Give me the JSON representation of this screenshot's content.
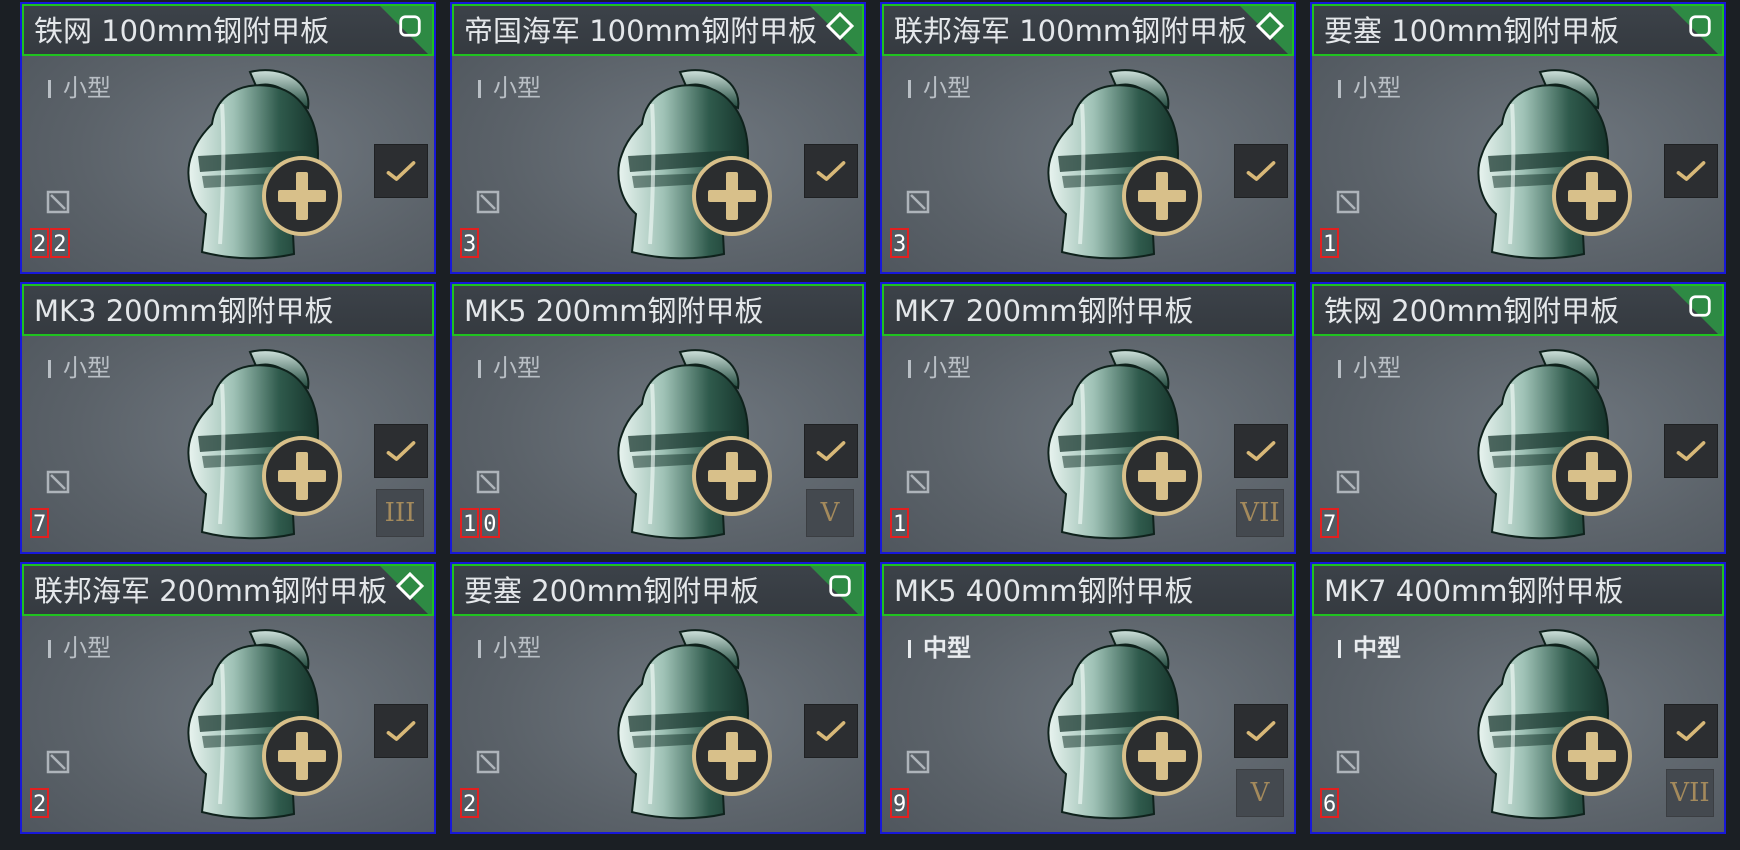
{
  "colors": {
    "card_border": "#1818d8",
    "title_border": "#1fc21f",
    "corner_badge": "#2e8a44",
    "count_border": "#e22020",
    "gold": "#d8c08a"
  },
  "items": [
    {
      "name": "铁网 100mm钢附甲板",
      "size": "小型",
      "count": "22",
      "tier": "",
      "corner": "square-icon",
      "medium": false
    },
    {
      "name": "帝国海军 100mm钢附甲板",
      "size": "小型",
      "count": "3",
      "tier": "",
      "corner": "diamond-icon",
      "medium": false
    },
    {
      "name": "联邦海军 100mm钢附甲板",
      "size": "小型",
      "count": "3",
      "tier": "",
      "corner": "diamond-icon",
      "medium": false
    },
    {
      "name": "要塞 100mm钢附甲板",
      "size": "小型",
      "count": "1",
      "tier": "",
      "corner": "square-icon",
      "medium": false
    },
    {
      "name": "MK3 200mm钢附甲板",
      "size": "小型",
      "count": "7",
      "tier": "III",
      "corner": "",
      "medium": false
    },
    {
      "name": "MK5 200mm钢附甲板",
      "size": "小型",
      "count": "10",
      "tier": "V",
      "corner": "",
      "medium": false
    },
    {
      "name": "MK7 200mm钢附甲板",
      "size": "小型",
      "count": "1",
      "tier": "VII",
      "corner": "",
      "medium": false
    },
    {
      "name": "铁网 200mm钢附甲板",
      "size": "小型",
      "count": "7",
      "tier": "",
      "corner": "square-icon",
      "medium": false
    },
    {
      "name": "联邦海军 200mm钢附甲板",
      "size": "小型",
      "count": "2",
      "tier": "",
      "corner": "diamond-icon",
      "medium": false
    },
    {
      "name": "要塞 200mm钢附甲板",
      "size": "小型",
      "count": "2",
      "tier": "",
      "corner": "square-icon",
      "medium": false
    },
    {
      "name": "MK5 400mm钢附甲板",
      "size": "中型",
      "count": "9",
      "tier": "V",
      "corner": "",
      "medium": true
    },
    {
      "name": "MK7 400mm钢附甲板",
      "size": "中型",
      "count": "6",
      "tier": "VII",
      "corner": "",
      "medium": true
    }
  ]
}
